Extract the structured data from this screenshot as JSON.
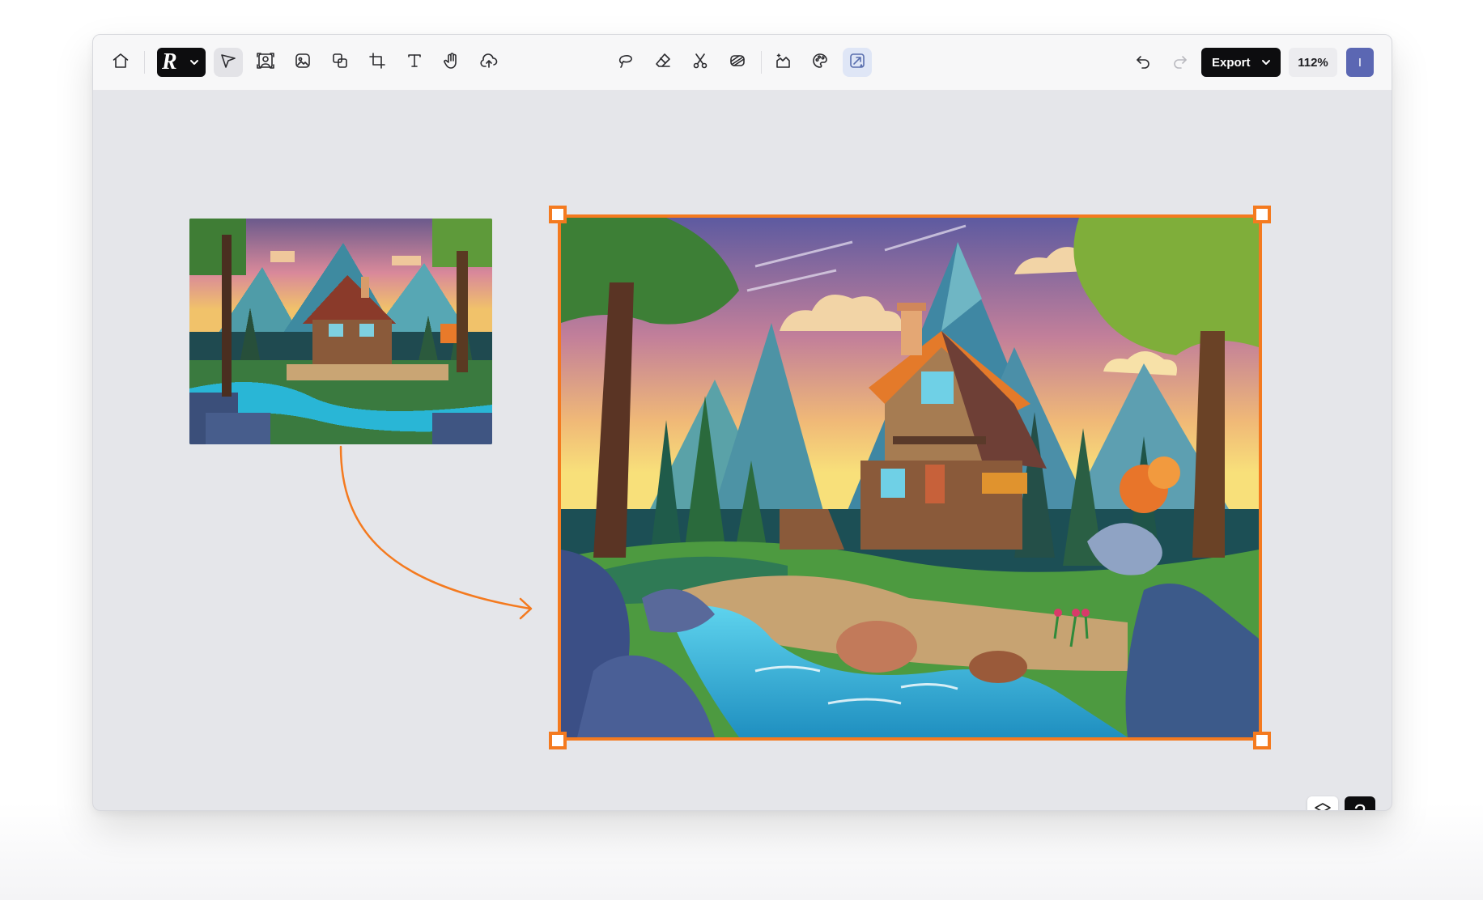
{
  "toolbar": {
    "left_tools": [
      {
        "name": "home",
        "icon": "home-icon"
      },
      {
        "name": "brand-menu",
        "icon": "brand-logo-icon"
      },
      {
        "name": "select",
        "icon": "pointer-icon",
        "active": true
      },
      {
        "name": "portrait-frame",
        "icon": "portrait-icon"
      },
      {
        "name": "image",
        "icon": "image-icon"
      },
      {
        "name": "layers-stack",
        "icon": "stack-icon"
      },
      {
        "name": "crop",
        "icon": "crop-icon"
      },
      {
        "name": "text",
        "icon": "text-icon"
      },
      {
        "name": "hand",
        "icon": "hand-icon"
      },
      {
        "name": "upload",
        "icon": "upload-icon"
      }
    ],
    "center_tools": [
      {
        "name": "lasso",
        "icon": "lasso-icon"
      },
      {
        "name": "eraser",
        "icon": "eraser-icon"
      },
      {
        "name": "cut",
        "icon": "scissors-icon"
      },
      {
        "name": "remove-background",
        "icon": "remove-bg-icon"
      },
      {
        "name": "generate",
        "icon": "generate-icon"
      },
      {
        "name": "palette",
        "icon": "palette-icon"
      },
      {
        "name": "upscale",
        "icon": "upscale-icon",
        "active": true
      }
    ],
    "right_tools": [
      {
        "name": "undo",
        "icon": "undo-icon"
      },
      {
        "name": "redo",
        "icon": "redo-icon",
        "disabled": true
      }
    ],
    "export_label": "Export",
    "zoom_level": "112%",
    "avatar_initial": "I"
  },
  "canvas": {
    "selection_color": "#f47a1f",
    "arrow_color": "#f47a1f",
    "background": "#e5e6ea",
    "source_image": "pixelated-cabin-thumbnail",
    "result_image": "upscaled-cabin-illustration"
  },
  "corner_controls": [
    {
      "name": "layers",
      "icon": "layers-icon"
    },
    {
      "name": "help",
      "icon": "help-icon",
      "label": "?"
    }
  ]
}
